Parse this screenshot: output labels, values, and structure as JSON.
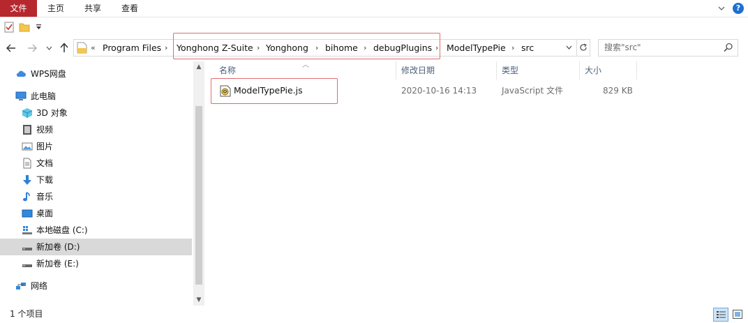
{
  "ribbon": {
    "tabs": [
      {
        "label": "文件",
        "active": true
      },
      {
        "label": "主页"
      },
      {
        "label": "共享"
      },
      {
        "label": "查看"
      }
    ],
    "accent_color": "#b7282e",
    "help_label": "?"
  },
  "address": {
    "overflow_label": "«",
    "segments": [
      "Program Files",
      "Yonghong Z-Suite",
      "Yonghong",
      "bihome",
      "debugPlugins",
      "ModelTypePie",
      "src"
    ],
    "separator": "›"
  },
  "search": {
    "placeholder": "搜索\"src\""
  },
  "nav": {
    "items": [
      {
        "label": "WPS网盘",
        "icon": "cloud-icon"
      },
      {
        "label": "此电脑",
        "icon": "computer-icon"
      },
      {
        "label": "3D 对象",
        "icon": "cube-icon"
      },
      {
        "label": "视频",
        "icon": "video-icon"
      },
      {
        "label": "图片",
        "icon": "picture-icon"
      },
      {
        "label": "文档",
        "icon": "document-icon"
      },
      {
        "label": "下载",
        "icon": "download-icon"
      },
      {
        "label": "音乐",
        "icon": "music-icon"
      },
      {
        "label": "桌面",
        "icon": "desktop-icon"
      },
      {
        "label": "本地磁盘 (C:)",
        "icon": "drive-c-icon"
      },
      {
        "label": "新加卷 (D:)",
        "icon": "drive-icon",
        "selected": true
      },
      {
        "label": "新加卷 (E:)",
        "icon": "drive-icon"
      },
      {
        "label": "网络",
        "icon": "network-icon"
      }
    ]
  },
  "columns": {
    "name": "名称",
    "modified": "修改日期",
    "type": "类型",
    "size": "大小"
  },
  "files": [
    {
      "name": "ModelTypePie.js",
      "modified": "2020-10-16 14:13",
      "type": "JavaScript 文件",
      "size": "829 KB",
      "icon": "javascript-file-icon"
    }
  ],
  "status": {
    "item_count": "1 个项目"
  },
  "highlight_color": "#e06b72"
}
